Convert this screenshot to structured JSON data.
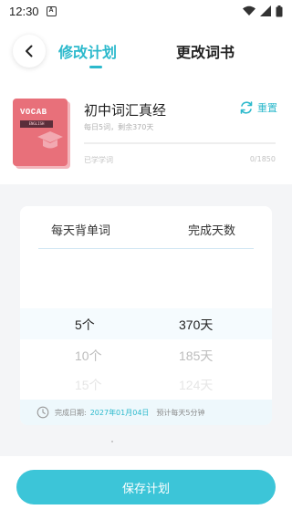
{
  "status_bar": {
    "time": "12:30",
    "notification_letter": "A"
  },
  "header": {
    "tabs": [
      {
        "label": "修改计划",
        "active": true
      },
      {
        "label": "更改词书",
        "active": false
      }
    ]
  },
  "book": {
    "cover_title": "VOCAB",
    "cover_tag": "ENGLISH",
    "title": "初中词汇真经",
    "subtitle": "每日5词，剩余370天",
    "reset_label": "重置",
    "progress_label": "已学学词",
    "progress_count": "0/1850",
    "progress_fraction": 0
  },
  "picker": {
    "left_header": "每天背单词",
    "right_header": "完成天数",
    "rows": [
      {
        "left": "5个",
        "right": "370天",
        "state": "selected"
      },
      {
        "left": "10个",
        "right": "185天",
        "state": "near"
      },
      {
        "left": "15个",
        "right": "124天",
        "state": "far"
      }
    ],
    "completion_prefix": "完成日期:",
    "completion_date": "2027年01月04日",
    "estimate": "预计每天5分钟"
  },
  "save_button": "保存计划",
  "colors": {
    "accent": "#2cb9cc",
    "button": "#3cc5d8",
    "cover": "#e8707a"
  }
}
